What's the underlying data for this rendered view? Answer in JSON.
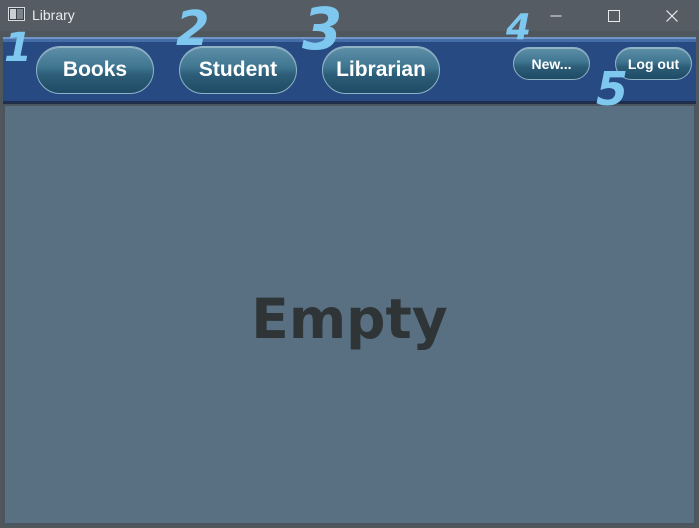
{
  "window": {
    "title": "Library",
    "controls": {
      "minimize": "minimize-icon",
      "maximize": "maximize-icon",
      "close": "close-icon"
    }
  },
  "navbar": {
    "books_label": "Books",
    "student_label": "Student",
    "librarian_label": "Librarian",
    "new_label": "New...",
    "logout_label": "Log out"
  },
  "main": {
    "empty_text": "Empty"
  },
  "annotations": [
    "1",
    "2",
    "3",
    "4",
    "5"
  ],
  "colors": {
    "navbar": "#284a82",
    "content": "#587081",
    "annotation": "#7ec8f0"
  }
}
